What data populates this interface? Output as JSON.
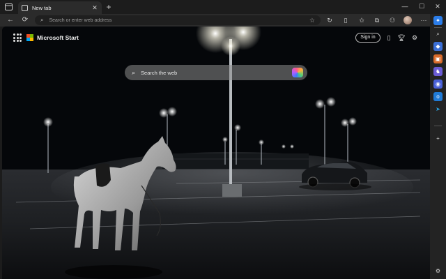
{
  "tab": {
    "title": "New tab",
    "close_glyph": "✕",
    "new_tab_glyph": "+"
  },
  "window_controls": {
    "minimize": "—",
    "maximize": "☐",
    "close": "✕"
  },
  "address_bar": {
    "placeholder": "Search or enter web address"
  },
  "start_page": {
    "brand": "Microsoft Start",
    "sign_in": "Sign in",
    "search_placeholder": "Search the web"
  },
  "toolbar_icons": [
    "tab-actions-icon",
    "back-icon",
    "refresh-icon",
    "star-icon",
    "collections-icon",
    "split-screen-icon",
    "favorites-icon",
    "copilot-icon",
    "profile-avatar",
    "more-icon"
  ],
  "sidebar_icons": [
    "search-icon",
    "shopping-icon",
    "tools-icon",
    "games-icon",
    "microsoft-365-icon",
    "outlook-icon",
    "send-icon",
    "add-icon",
    "settings-icon"
  ],
  "colors": {
    "chrome_bg": "#1c1c1c",
    "toolbar_bg": "#2b2b2b",
    "accent_blue": "#3a8ee6"
  }
}
